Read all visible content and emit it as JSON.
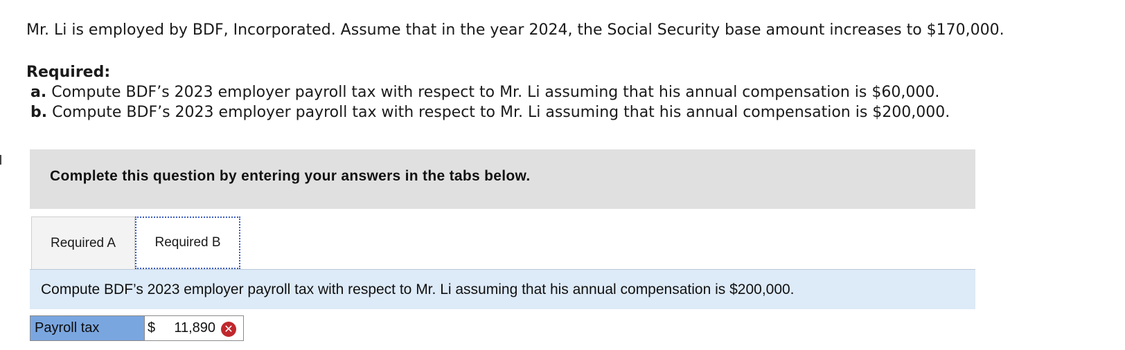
{
  "problem": {
    "intro": "Mr. Li is employed by BDF, Incorporated. Assume that in the year 2024, the Social Security base amount increases to $170,000.",
    "required_title": "Required:",
    "items": [
      {
        "letter": "a.",
        "text": "Compute BDF’s 2023 employer payroll tax with respect to Mr. Li assuming that his annual compensation is $60,000."
      },
      {
        "letter": "b.",
        "text": "Compute BDF’s 2023 employer payroll tax with respect to Mr. Li assuming that his annual compensation is $200,000."
      }
    ]
  },
  "instruction": "Complete this question by entering your answers in the tabs below.",
  "tabs": [
    {
      "label": "Required A",
      "active": false
    },
    {
      "label": "Required B",
      "active": true
    }
  ],
  "active_question": "Compute BDF’s 2023 employer payroll tax with respect to Mr. Li assuming that his annual compensation is $200,000.",
  "answer": {
    "label": "Payroll tax",
    "currency": "$",
    "value": "11,890",
    "status": "incorrect",
    "status_icon": "x-circle-icon",
    "status_color": "#c0282d"
  },
  "colors": {
    "instruction_bg": "#e0e0e0",
    "question_bg": "#ddeaf7",
    "label_bg": "#7aa6e0",
    "active_tab_border": "#3a5bbf"
  }
}
